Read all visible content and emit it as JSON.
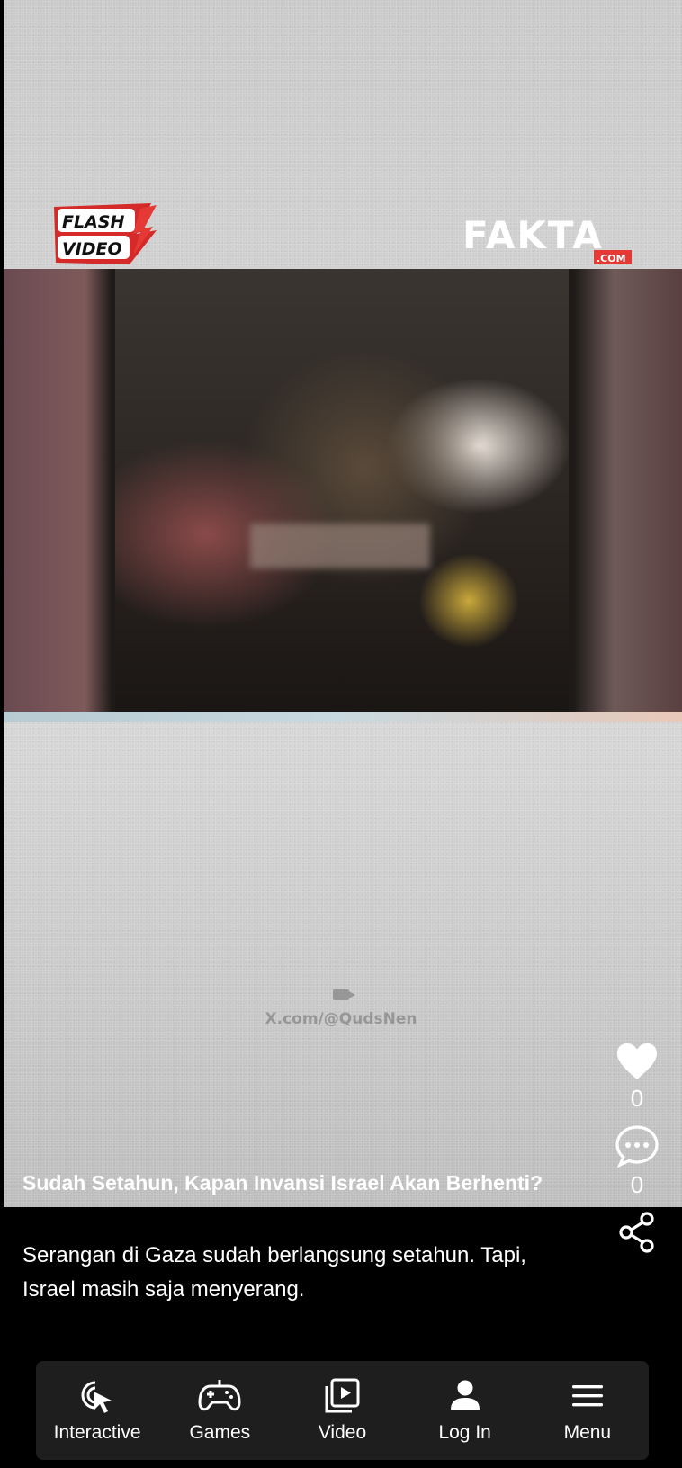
{
  "overlay": {
    "flash_logo": {
      "line1": "FLASH",
      "line2": "VIDEO"
    },
    "fakta_logo": {
      "word": "FAKTA",
      "domain": ".COM"
    },
    "watermark": "X.com/@QudsNen",
    "accent_color": "#e53935"
  },
  "caption": {
    "title": "Sudah Setahun, Kapan Invansi Israel Akan Berhenti?",
    "description": "Serangan di Gaza sudah berlangsung setahun. Tapi, Israel masih saja menyerang."
  },
  "actions": {
    "like": {
      "icon": "heart-icon",
      "count": "0"
    },
    "comment": {
      "icon": "comment-icon",
      "count": "0"
    },
    "share": {
      "icon": "share-icon"
    }
  },
  "nav": [
    {
      "label": "Interactive",
      "icon": "cursor-click-icon"
    },
    {
      "label": "Games",
      "icon": "gamepad-icon"
    },
    {
      "label": "Video",
      "icon": "video-play-icon"
    },
    {
      "label": "Log In",
      "icon": "user-icon"
    },
    {
      "label": "Menu",
      "icon": "hamburger-icon"
    }
  ]
}
